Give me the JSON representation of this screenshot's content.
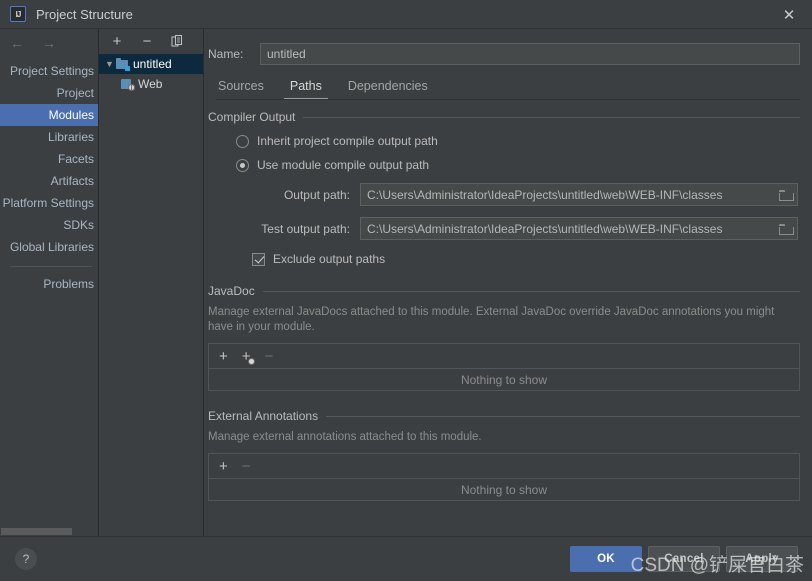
{
  "window": {
    "title": "Project Structure",
    "app_icon": "IJ",
    "close_icon": "close-icon"
  },
  "nav": {
    "back_icon": "arrow-left-icon",
    "forward_icon": "arrow-right-icon",
    "items": [
      {
        "label": "Project Settings",
        "type": "header",
        "selected": false
      },
      {
        "label": "Project",
        "type": "item",
        "selected": false
      },
      {
        "label": "Modules",
        "type": "item",
        "selected": true
      },
      {
        "label": "Libraries",
        "type": "item",
        "selected": false
      },
      {
        "label": "Facets",
        "type": "item",
        "selected": false
      },
      {
        "label": "Artifacts",
        "type": "item",
        "selected": false
      },
      {
        "label": "Platform Settings",
        "type": "header",
        "selected": false
      },
      {
        "label": "SDKs",
        "type": "item",
        "selected": false
      },
      {
        "label": "Global Libraries",
        "type": "item",
        "selected": false
      }
    ],
    "after_separator": [
      {
        "label": "Problems",
        "type": "item",
        "selected": false
      }
    ]
  },
  "tree": {
    "toolbar": {
      "add_label": "+",
      "remove_label": "−",
      "copy_label": "❐"
    },
    "nodes": [
      {
        "label": "untitled",
        "icon": "module-icon",
        "expanded": true,
        "selected": true,
        "depth": 0
      },
      {
        "label": "Web",
        "icon": "web-facet-icon",
        "expanded": false,
        "selected": false,
        "depth": 1
      }
    ]
  },
  "main": {
    "name_label": "Name:",
    "name_value": "untitled",
    "name_placeholder": "Name",
    "tabs": [
      {
        "label": "Sources",
        "active": false
      },
      {
        "label": "Paths",
        "active": true
      },
      {
        "label": "Dependencies",
        "active": false
      }
    ],
    "compiler_output": {
      "title": "Compiler Output",
      "radio_inherit": {
        "label": "Inherit project compile output path",
        "checked": false
      },
      "radio_module": {
        "label": "Use module compile output path",
        "checked": true
      },
      "output_path": {
        "label": "Output path:",
        "value": "C:\\Users\\Administrator\\IdeaProjects\\untitled\\web\\WEB-INF\\classes",
        "browse_icon": "folder-browse-icon"
      },
      "test_output_path": {
        "label": "Test output path:",
        "value": "C:\\Users\\Administrator\\IdeaProjects\\untitled\\web\\WEB-INF\\classes",
        "browse_icon": "folder-browse-icon"
      },
      "exclude_checkbox": {
        "label": "Exclude output paths",
        "checked": true
      }
    },
    "javadoc": {
      "title": "JavaDoc",
      "description": "Manage external JavaDocs attached to this module. External JavaDoc override JavaDoc annotations you might have in your module.",
      "toolbar": {
        "add_label": "+",
        "add_download_label": "+",
        "remove_label": "−"
      },
      "empty_text": "Nothing to show"
    },
    "external_annotations": {
      "title": "External Annotations",
      "description": "Manage external annotations attached to this module.",
      "toolbar": {
        "add_label": "+",
        "remove_label": "−"
      },
      "empty_text": "Nothing to show"
    }
  },
  "footer": {
    "help_label": "?",
    "buttons": [
      {
        "label": "OK",
        "primary": true
      },
      {
        "label": "Cancel",
        "primary": false
      },
      {
        "label": "Apply",
        "primary": false
      }
    ]
  },
  "watermark": {
    "text": "CSDN @铲屎官白茶"
  },
  "colors": {
    "background": "#3c3f41",
    "accent": "#4b6eaf",
    "tree_selection": "#0d293e",
    "input_background": "#45494a",
    "text": "#bbbbbb",
    "muted_text": "#8c8c8c"
  }
}
